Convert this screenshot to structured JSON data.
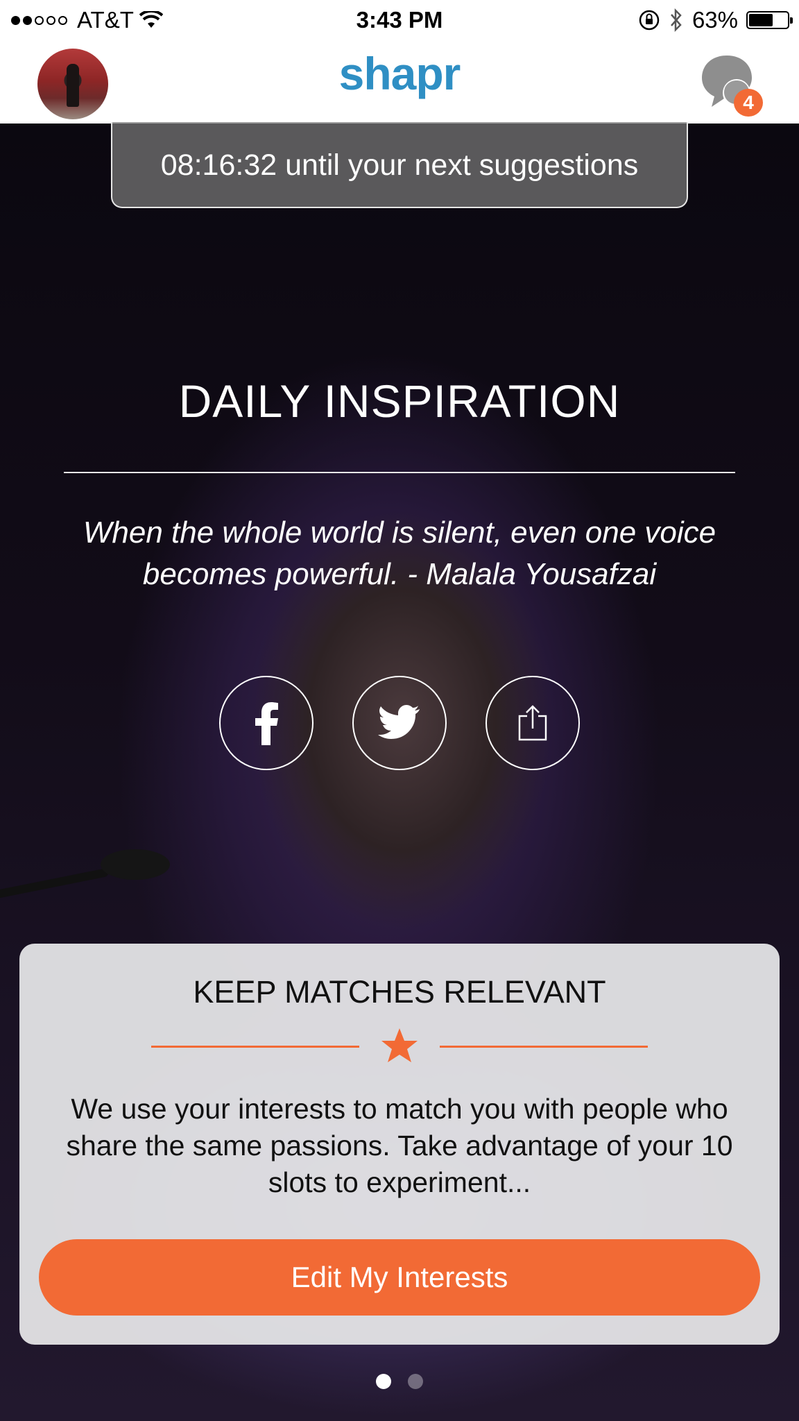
{
  "status_bar": {
    "signal_dots": {
      "filled": 2,
      "empty": 3
    },
    "carrier": "AT&T",
    "time": "3:43 PM",
    "battery_percent": "63%",
    "battery_level": 0.63,
    "icons": [
      "wifi-icon",
      "rotation-lock-icon",
      "bluetooth-icon",
      "battery-icon"
    ]
  },
  "nav": {
    "brand": "shapr",
    "chat_badge_count": "4"
  },
  "timer": {
    "text": "08:16:32 until your next suggestions"
  },
  "inspiration": {
    "title": "DAILY INSPIRATION",
    "quote": "When the whole world is silent, even one voice becomes powerful. - Malala Yousafzai",
    "share_icons": [
      "facebook-icon",
      "twitter-icon",
      "share-icon"
    ]
  },
  "card": {
    "title": "KEEP MATCHES RELEVANT",
    "body": "We use your interests to match you with people who share the same passions. Take advantage of your 10 slots to experiment...",
    "cta_label": "Edit My Interests"
  },
  "pager": {
    "pages": 2,
    "active_index": 0
  },
  "colors": {
    "accent": "#f26a35",
    "brand": "#2f8fc4",
    "card_bg": "#e6e6e8"
  }
}
